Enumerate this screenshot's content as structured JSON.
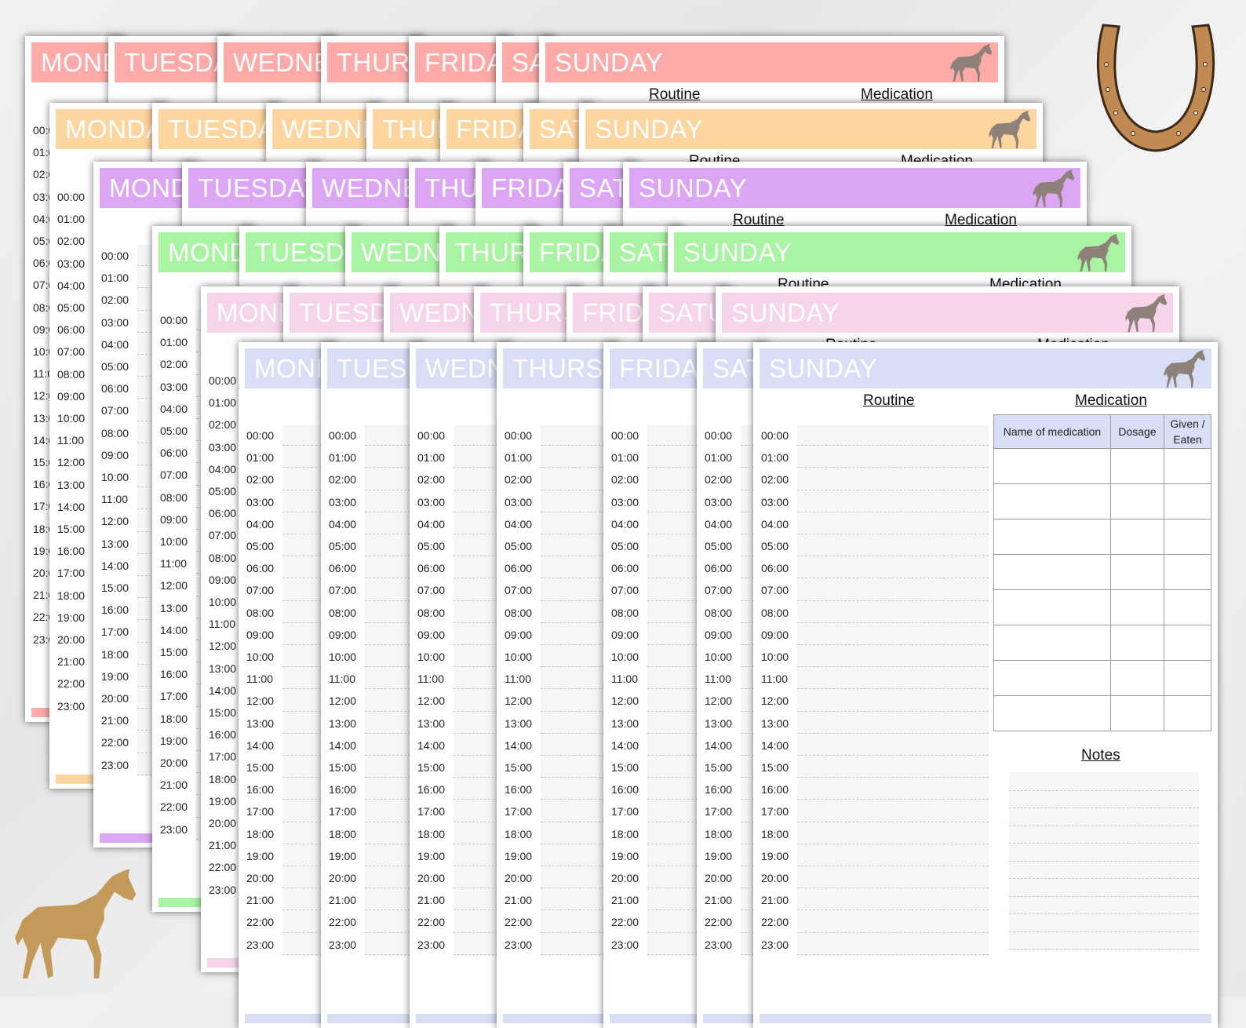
{
  "days": [
    "MONDAY",
    "TUESDAY",
    "WEDNESDAY",
    "THURSDAY",
    "FRIDAY",
    "SATURDAY",
    "SUNDAY"
  ],
  "hours": [
    "00:00",
    "01:00",
    "02:00",
    "03:00",
    "04:00",
    "05:00",
    "06:00",
    "07:00",
    "08:00",
    "09:00",
    "10:00",
    "11:00",
    "12:00",
    "13:00",
    "14:00",
    "15:00",
    "16:00",
    "17:00",
    "18:00",
    "19:00",
    "20:00",
    "21:00",
    "22:00",
    "23:00"
  ],
  "colors": {
    "red": "#fdaaa8",
    "orange": "#fdd59e",
    "purple": "#dca6f5",
    "green": "#a8f4a2",
    "pink": "#f6d4ea",
    "blue": "#d7def6",
    "horse": "#8d8179",
    "gold": "#c49a5a",
    "horseshoe": "#c08a52"
  },
  "sunday_page": {
    "routine_title": "Routine",
    "medication_title": "Medication",
    "notes_title": "Notes",
    "table_headers": [
      "Name of medication",
      "Dosage",
      "Given / Eaten"
    ]
  },
  "decor": {
    "horseshoe_icon": "horseshoe-icon",
    "horse_silhouette_icon": "horse-silhouette-icon"
  }
}
